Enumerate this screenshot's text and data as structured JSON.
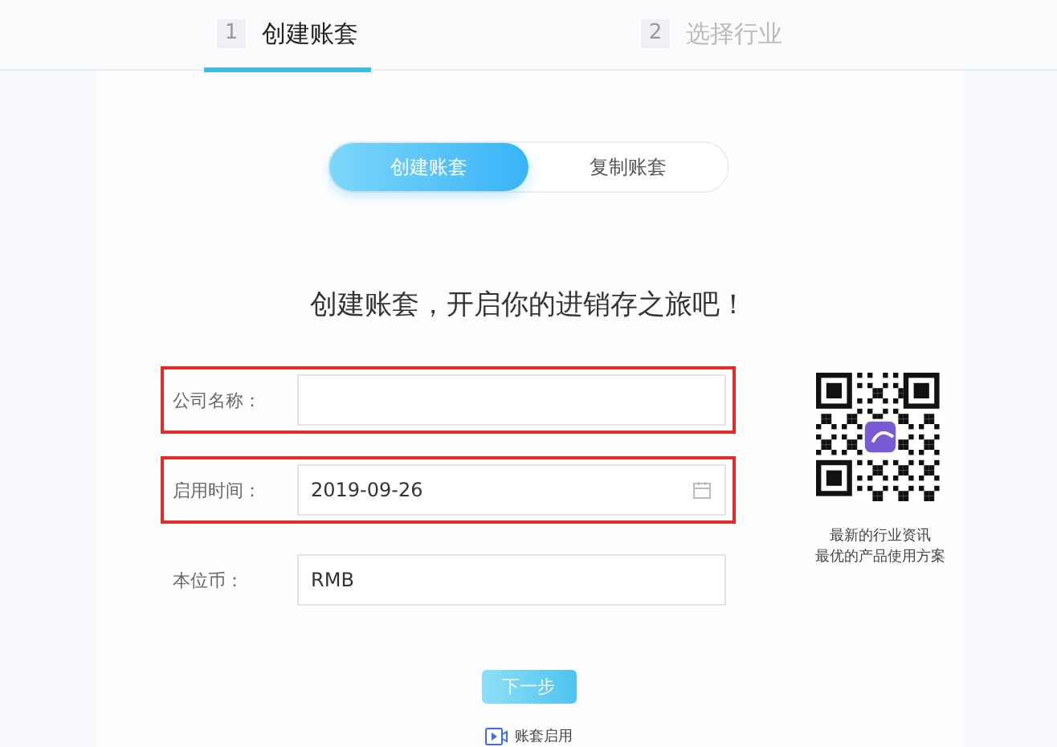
{
  "steps": [
    {
      "number": "1",
      "label": "创建账套",
      "selected": true
    },
    {
      "number": "2",
      "label": "选择行业",
      "selected": false
    }
  ],
  "mode_toggle": [
    {
      "label": "创建账套",
      "selected": true
    },
    {
      "label": "复制账套",
      "selected": false
    }
  ],
  "heading": "创建账套，开启你的进销存之旅吧！",
  "form": [
    {
      "kind": "text",
      "label": "公司名称：",
      "highlighted": true
    },
    {
      "kind": "date",
      "label": "启用时间：",
      "value": "2019-09-26",
      "highlighted": true
    },
    {
      "kind": "text",
      "label": "本位币：",
      "value": "RMB",
      "highlighted": false
    }
  ],
  "qr_caption": [
    "最新的行业资讯",
    "最优的产品使用方案"
  ],
  "next_button": "下一步",
  "video_link": "账套启用"
}
